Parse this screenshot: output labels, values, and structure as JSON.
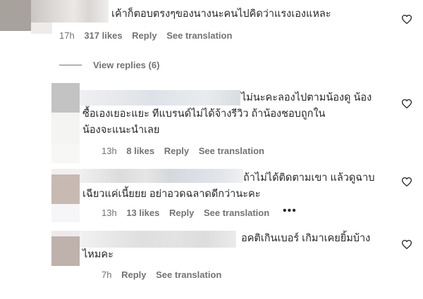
{
  "comments": [
    {
      "text_lines": [
        "เค้าก็ตอบตรงๆของนางนะคนไปคิดว่าแรงเองแหละ"
      ],
      "time": "17h",
      "likes": "317 likes",
      "reply_label": "Reply",
      "translate_label": "See translation"
    },
    {
      "text_lines": [
        "ไม่นะคะลองไปตามน้องดู น้อง",
        "ซื้อเองเยอะแยะ ทีแบรนด์ไม่ได้จ้างรีวิว ถ้าน้องชอบถูกใน",
        "น้องจะแนะนำเลย"
      ],
      "time": "13h",
      "likes": "8 likes",
      "reply_label": "Reply",
      "translate_label": "See translation"
    },
    {
      "text_lines": [
        "ถ้าไม่ได้ติดตามเขา แล้วดูฉาบ",
        "เฉียวแค่เนี้ยยย อย่าอวดฉลาดดีกว่านะคะ"
      ],
      "time": "13h",
      "likes": "13 likes",
      "reply_label": "Reply",
      "translate_label": "See translation",
      "more": "•••"
    },
    {
      "text_lines": [
        "อคติเกินเบอร์ เกิมาเคยยิ้มบ้าง",
        "ไหมคะ"
      ],
      "time": "7h",
      "reply_label": "Reply",
      "translate_label": "See translation"
    }
  ],
  "view_replies_label": "View replies (6)",
  "icons": {
    "heart": "heart-icon",
    "more": "more-options-icon"
  },
  "colors": {
    "text": "#262626",
    "meta": "#737373"
  }
}
